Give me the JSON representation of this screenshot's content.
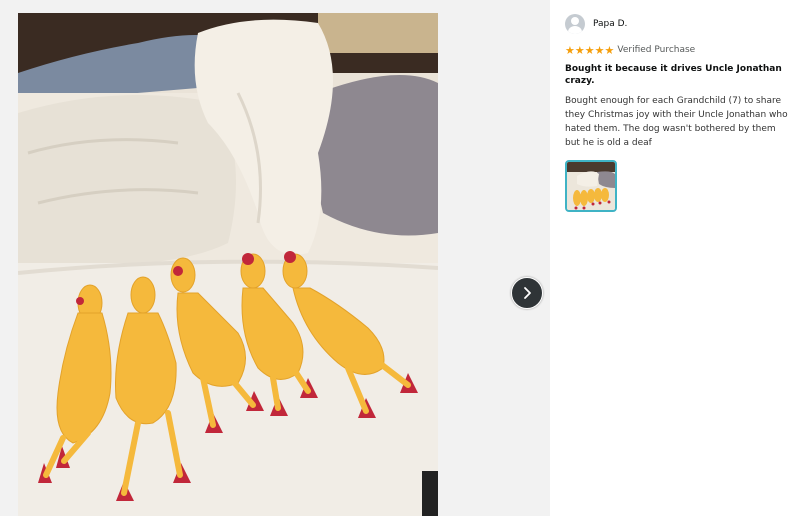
{
  "viewer": {
    "photo_icon": "rubber-chickens-photo",
    "next_icon": "chevron-right-icon"
  },
  "review": {
    "reviewer_name": "Papa D.",
    "avatar_icon": "default-user-avatar",
    "rating": 5,
    "rating_max": 5,
    "star_glyph": "★",
    "star_color": "#f59e0b",
    "verified_label": "Verified Purchase",
    "title": "Bought it because it drives Uncle Jonathan crazy.",
    "body": "Bought enough for each Grandchild (7) to share they Christmas joy with their Uncle Jonathan who hated them. The dog wasn't bothered by them but he is old a deaf",
    "thumbnail_selected_color": "#3fb3c5"
  }
}
